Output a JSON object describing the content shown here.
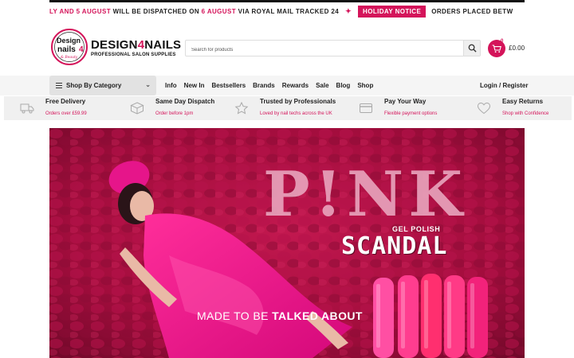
{
  "ticker": {
    "segment1_pink": "LY AND 5 AUGUST",
    "segment1_text": " WILL BE DISPATCHED ON ",
    "segment1_pink2": "6 AUGUST",
    "segment1_text2": " VIA ROYAL MAIL TRACKED 24",
    "star": "✦",
    "badge": "HOLIDAY NOTICE",
    "segment2_text": "ORDERS PLACED BETW"
  },
  "header": {
    "brand_name_a": "DESIGN",
    "brand_name_b": "4",
    "brand_name_c": "NAILS",
    "brand_tagline": "PROFESSIONAL SALON SUPPLIES",
    "logo_text_a": "Design",
    "logo_text_b": "nails",
    "logo_text_c": "4",
    "logo_text_d": "& Beauty",
    "search_placeholder": "Search for products",
    "cart_count": "0",
    "cart_total": "£0.00"
  },
  "nav": {
    "category_label": "Shop By Category",
    "links": [
      "Info",
      "New In",
      "Bestsellers",
      "Brands",
      "Rewards",
      "Sale",
      "Blog",
      "Shop"
    ],
    "login_label": "Login / Register"
  },
  "features": [
    {
      "title": "Free Delivery",
      "sub": "Orders over £59.99",
      "icon": "truck-icon"
    },
    {
      "title": "Same Day Dispatch",
      "sub": "Order before 1pm",
      "icon": "box-icon"
    },
    {
      "title": "Trusted by Professionals",
      "sub": "Loved by nail techs across the UK",
      "icon": "star-icon"
    },
    {
      "title": "Pay Your Way",
      "sub": "Flexible payment options",
      "icon": "card-icon"
    },
    {
      "title": "Easy Returns",
      "sub": "Shop with Confidence",
      "icon": "heart-icon"
    }
  ],
  "hero": {
    "brand_word": "P!NK",
    "gel_label": "GEL POLISH",
    "product_word": "SCANDAL",
    "slogan_a": "MADE TO BE ",
    "slogan_b": "TALKED ABOUT"
  },
  "colors": {
    "accent": "#d4145a",
    "hero_bg": "#a60f3e",
    "nav_bg": "#f5f5f5"
  }
}
